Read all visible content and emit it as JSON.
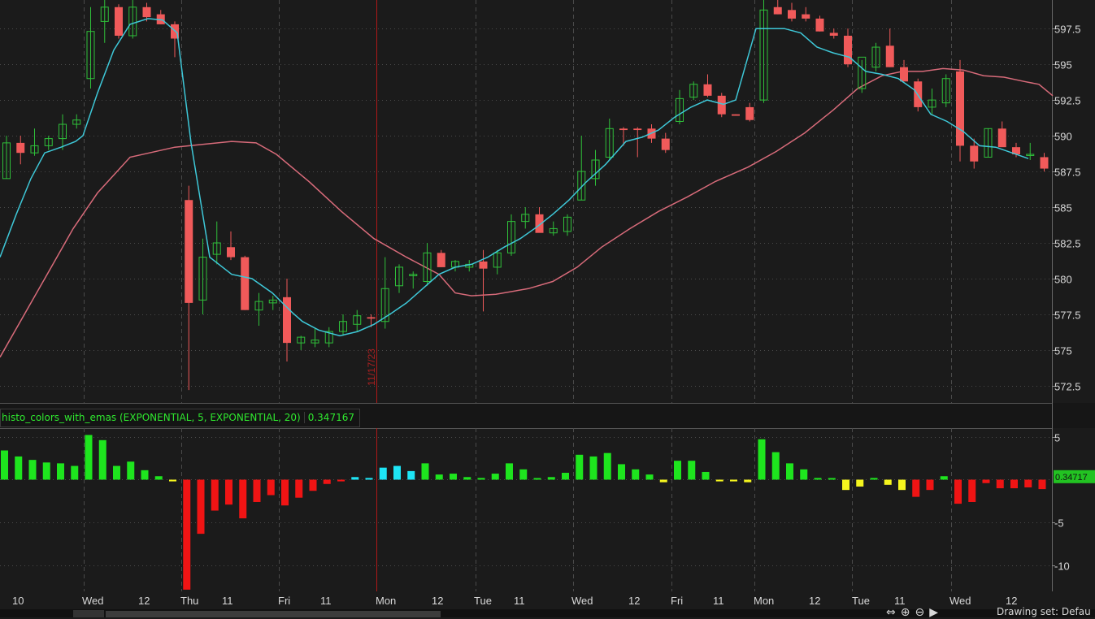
{
  "colors": {
    "background": "#1b1b1b",
    "grid": "#4a4a4a",
    "candle_up": "#2fc03a",
    "candle_down": "#f05a5a",
    "ema_fast": "#3ec8d8",
    "ema_slow": "#d86b7a",
    "histo_green": "#1ee51e",
    "histo_red": "#f01414",
    "histo_cyan": "#1ee5f5",
    "histo_yellow": "#f5f51e",
    "price_text": "#d8d8d8",
    "date_marker": "#b01818"
  },
  "date_marker_label": "11/17/23",
  "study": {
    "name": "histo_colors_with_emas (EXPONENTIAL, 5, EXPONENTIAL, 20)",
    "value": "0.347167",
    "value_badge": "0.34717"
  },
  "price_axis": {
    "ticks": [
      "597.5",
      "595",
      "592.5",
      "590",
      "587.5",
      "585",
      "582.5",
      "580",
      "577.5",
      "575",
      "572.5"
    ]
  },
  "histo_axis": {
    "ticks": [
      "5",
      "-5",
      "-10"
    ]
  },
  "time_axis": {
    "labels": [
      "10",
      "Wed",
      "12",
      "Thu",
      "11",
      "Fri",
      "11",
      "Mon",
      "12",
      "Tue",
      "11",
      "Wed",
      "12",
      "Fri",
      "11",
      "Mon",
      "12",
      "Tue",
      "11",
      "Wed",
      "12"
    ]
  },
  "status_bar": {
    "drawing_set": "Drawing set: Defau"
  },
  "chart_data": {
    "type": "candlestick",
    "price_range": [
      571.3,
      599.5
    ],
    "histogram_range": [
      -13,
      6
    ],
    "candles": [
      {
        "o": 587,
        "h": 590,
        "l": 587,
        "c": 589.5
      },
      {
        "o": 589.5,
        "h": 590,
        "l": 588,
        "c": 588.8
      },
      {
        "o": 588.8,
        "h": 590.5,
        "l": 588.6,
        "c": 589.3
      },
      {
        "o": 589.3,
        "h": 590,
        "l": 589,
        "c": 589.8
      },
      {
        "o": 589.8,
        "h": 591.5,
        "l": 589,
        "c": 590.8
      },
      {
        "o": 590.8,
        "h": 591.5,
        "l": 590.5,
        "c": 591.1
      },
      {
        "o": 594,
        "h": 599,
        "l": 593.3,
        "c": 597.3
      },
      {
        "o": 598,
        "h": 599.8,
        "l": 596.5,
        "c": 599
      },
      {
        "o": 599,
        "h": 599.2,
        "l": 596.8,
        "c": 597
      },
      {
        "o": 597,
        "h": 599.5,
        "l": 596.8,
        "c": 599
      },
      {
        "o": 599,
        "h": 599.3,
        "l": 598,
        "c": 598.3
      },
      {
        "o": 598.5,
        "h": 598.8,
        "l": 597.8,
        "c": 597.8
      },
      {
        "o": 597.8,
        "h": 598,
        "l": 595.5,
        "c": 596.8
      },
      {
        "o": 585.5,
        "h": 586.5,
        "l": 572.2,
        "c": 578.3
      },
      {
        "o": 578.5,
        "h": 582.8,
        "l": 577.5,
        "c": 581.5
      },
      {
        "o": 581.7,
        "h": 584,
        "l": 581,
        "c": 582.5
      },
      {
        "o": 582.2,
        "h": 583.3,
        "l": 581.3,
        "c": 581.5
      },
      {
        "o": 581.5,
        "h": 581.6,
        "l": 577.8,
        "c": 577.8
      },
      {
        "o": 577.8,
        "h": 579,
        "l": 576.7,
        "c": 578.4
      },
      {
        "o": 578.3,
        "h": 578.8,
        "l": 577.8,
        "c": 578.5
      },
      {
        "o": 578.7,
        "h": 580,
        "l": 574.2,
        "c": 575.5
      },
      {
        "o": 575.5,
        "h": 576,
        "l": 575,
        "c": 575.9
      },
      {
        "o": 575.5,
        "h": 576.5,
        "l": 575.2,
        "c": 575.7
      },
      {
        "o": 575.5,
        "h": 576.6,
        "l": 575.2,
        "c": 576.3
      },
      {
        "o": 576.3,
        "h": 577.5,
        "l": 576,
        "c": 577
      },
      {
        "o": 576.8,
        "h": 577.8,
        "l": 576.3,
        "c": 577.4
      },
      {
        "o": 577.3,
        "h": 577.5,
        "l": 576.6,
        "c": 577.2
      },
      {
        "o": 577,
        "h": 581.5,
        "l": 576.5,
        "c": 579.3
      },
      {
        "o": 579.5,
        "h": 581,
        "l": 579,
        "c": 580.8
      },
      {
        "o": 580.2,
        "h": 580.5,
        "l": 579.3,
        "c": 580.3
      },
      {
        "o": 579.8,
        "h": 582.5,
        "l": 579.5,
        "c": 581.8
      },
      {
        "o": 581.8,
        "h": 582,
        "l": 580.8,
        "c": 580.8
      },
      {
        "o": 580.8,
        "h": 581.3,
        "l": 580.5,
        "c": 581.2
      },
      {
        "o": 580.8,
        "h": 581.3,
        "l": 580.5,
        "c": 581
      },
      {
        "o": 581.2,
        "h": 582,
        "l": 577.7,
        "c": 580.7
      },
      {
        "o": 580.8,
        "h": 582,
        "l": 580.3,
        "c": 581.8
      },
      {
        "o": 581.8,
        "h": 584.5,
        "l": 581.6,
        "c": 584
      },
      {
        "o": 584,
        "h": 585,
        "l": 583.5,
        "c": 584.5
      },
      {
        "o": 584.5,
        "h": 585,
        "l": 583.5,
        "c": 583.2
      },
      {
        "o": 583.2,
        "h": 584,
        "l": 583,
        "c": 583.5
      },
      {
        "o": 583.3,
        "h": 584.5,
        "l": 583,
        "c": 584.3
      },
      {
        "o": 585.5,
        "h": 590,
        "l": 585.5,
        "c": 587.5
      },
      {
        "o": 587,
        "h": 589,
        "l": 586.5,
        "c": 588.3
      },
      {
        "o": 588.5,
        "h": 591.2,
        "l": 588.3,
        "c": 590.5
      },
      {
        "o": 590.5,
        "h": 590.6,
        "l": 589.3,
        "c": 590.4
      },
      {
        "o": 590.5,
        "h": 590.6,
        "l": 588.5,
        "c": 590.4
      },
      {
        "o": 590.5,
        "h": 590.8,
        "l": 589.5,
        "c": 589.8
      },
      {
        "o": 589.8,
        "h": 590.2,
        "l": 588.8,
        "c": 589
      },
      {
        "o": 591,
        "h": 593.2,
        "l": 590.8,
        "c": 592.6
      },
      {
        "o": 592.7,
        "h": 593.8,
        "l": 592.5,
        "c": 593.6
      },
      {
        "o": 593.6,
        "h": 594.3,
        "l": 592.7,
        "c": 592.8
      },
      {
        "o": 592.8,
        "h": 593,
        "l": 591.3,
        "c": 591.5
      },
      {
        "o": 591.5,
        "h": 591.5,
        "l": 591.4,
        "c": 591.4
      },
      {
        "o": 592,
        "h": 592.3,
        "l": 591,
        "c": 591.1
      },
      {
        "o": 592.5,
        "h": 599.5,
        "l": 592.3,
        "c": 598.8
      },
      {
        "o": 599,
        "h": 599.8,
        "l": 598.5,
        "c": 598.5
      },
      {
        "o": 598.8,
        "h": 599.3,
        "l": 598,
        "c": 598.2
      },
      {
        "o": 598.5,
        "h": 599,
        "l": 598,
        "c": 598.2
      },
      {
        "o": 598.2,
        "h": 598.4,
        "l": 597.3,
        "c": 597.3
      },
      {
        "o": 597.2,
        "h": 597.5,
        "l": 596.8,
        "c": 597
      },
      {
        "o": 597,
        "h": 597.5,
        "l": 594.8,
        "c": 595
      },
      {
        "o": 593.3,
        "h": 595.3,
        "l": 593,
        "c": 595.5
      },
      {
        "o": 594.8,
        "h": 596.5,
        "l": 594.5,
        "c": 596.2
      },
      {
        "o": 596.3,
        "h": 597.5,
        "l": 594.8,
        "c": 594.8
      },
      {
        "o": 594.8,
        "h": 595.3,
        "l": 593.8,
        "c": 593.8
      },
      {
        "o": 593.8,
        "h": 594,
        "l": 591.7,
        "c": 592
      },
      {
        "o": 592,
        "h": 593.3,
        "l": 591.5,
        "c": 592.5
      },
      {
        "o": 592.3,
        "h": 594.3,
        "l": 592,
        "c": 594
      },
      {
        "o": 594.5,
        "h": 595.3,
        "l": 588.2,
        "c": 589.3
      },
      {
        "o": 589.3,
        "h": 589.8,
        "l": 587.7,
        "c": 588.2
      },
      {
        "o": 588.5,
        "h": 590.5,
        "l": 588.5,
        "c": 590.5
      },
      {
        "o": 590.5,
        "h": 591,
        "l": 589.3,
        "c": 589.2
      },
      {
        "o": 589.2,
        "h": 589.5,
        "l": 588.5,
        "c": 588.7
      },
      {
        "o": 588.7,
        "h": 589.5,
        "l": 588.3,
        "c": 588.7
      },
      {
        "o": 588.5,
        "h": 588.8,
        "l": 587.5,
        "c": 587.7
      }
    ],
    "ema_fast": [
      581.5,
      584.5,
      587,
      588.8,
      589.2,
      589.6,
      590,
      593,
      596,
      597.8,
      598.2,
      598.1,
      597.2,
      589.5,
      581.5,
      580.3,
      580,
      579,
      577.6,
      577,
      576.4,
      576,
      576.3,
      576.8,
      577.6,
      578.3,
      579.3,
      580.3,
      580.8,
      581,
      581.5,
      582.2,
      582.8,
      583.6,
      584.5,
      585.5,
      586.7,
      588,
      589.6,
      589.9,
      590.4,
      591.3,
      592,
      592.5,
      592.2,
      592.5,
      597.5,
      597.5,
      597.2,
      596.2,
      595.8,
      595.5,
      594.5,
      594.3,
      594,
      593.2,
      591.5,
      591,
      590.3,
      589.3,
      589.2,
      588.8,
      588.4
    ],
    "ema_fast_x": [
      0,
      20,
      38,
      55,
      75,
      93,
      102,
      120,
      140,
      160,
      182,
      200,
      218,
      235,
      258,
      285,
      310,
      335,
      360,
      372,
      392,
      418,
      440,
      460,
      482,
      500,
      520,
      540,
      560,
      580,
      600,
      620,
      640,
      660,
      680,
      700,
      720,
      745,
      770,
      790,
      810,
      830,
      850,
      870,
      890,
      905,
      930,
      965,
      985,
      1005,
      1025,
      1045,
      1065,
      1085,
      1105,
      1125,
      1145,
      1165,
      1185,
      1205,
      1225,
      1245,
      1265,
      1285,
      1295
    ],
    "ema_slow": [
      574.5,
      577.5,
      580.5,
      583.5,
      586,
      588.5,
      589.2,
      589.6,
      589.5,
      588.7,
      586.8,
      584.7,
      582.8,
      581.5,
      580.3,
      579,
      578.8,
      578.9,
      579.3,
      579.8,
      580.8,
      582.2,
      583.5,
      584.7,
      585.7,
      586.8,
      587.8,
      588.9,
      590.2,
      591.8,
      593.3,
      594.2,
      594.5,
      594.5,
      594.7,
      594.6,
      594.2,
      594.1,
      593.8,
      593.6,
      592.8
    ],
    "ema_slow_x": [
      0,
      30,
      60,
      90,
      120,
      160,
      215,
      285,
      315,
      340,
      380,
      420,
      460,
      500,
      540,
      560,
      580,
      610,
      650,
      680,
      710,
      740,
      775,
      810,
      845,
      880,
      920,
      955,
      990,
      1025,
      1055,
      1085,
      1110,
      1135,
      1160,
      1185,
      1210,
      1235,
      1260,
      1278,
      1295
    ],
    "histogram": [
      {
        "v": 3.4,
        "c": "g"
      },
      {
        "v": 2.7,
        "c": "g"
      },
      {
        "v": 2.3,
        "c": "g"
      },
      {
        "v": 2,
        "c": "g"
      },
      {
        "v": 1.9,
        "c": "g"
      },
      {
        "v": 1.6,
        "c": "g"
      },
      {
        "v": 5.2,
        "c": "g"
      },
      {
        "v": 4.6,
        "c": "g"
      },
      {
        "v": 1.6,
        "c": "g"
      },
      {
        "v": 2.1,
        "c": "g"
      },
      {
        "v": 1.1,
        "c": "g"
      },
      {
        "v": 0.4,
        "c": "g"
      },
      {
        "v": -0.2,
        "c": "y"
      },
      {
        "v": -12.8,
        "c": "r"
      },
      {
        "v": -6.3,
        "c": "r"
      },
      {
        "v": -3.6,
        "c": "r"
      },
      {
        "v": -2.9,
        "c": "r"
      },
      {
        "v": -4.5,
        "c": "r"
      },
      {
        "v": -2.6,
        "c": "r"
      },
      {
        "v": -1.8,
        "c": "r"
      },
      {
        "v": -3,
        "c": "r"
      },
      {
        "v": -2.1,
        "c": "r"
      },
      {
        "v": -1.3,
        "c": "r"
      },
      {
        "v": -0.5,
        "c": "r"
      },
      {
        "v": -0.2,
        "c": "r"
      },
      {
        "v": 0.3,
        "c": "c"
      },
      {
        "v": 0.2,
        "c": "c"
      },
      {
        "v": 1.4,
        "c": "c"
      },
      {
        "v": 1.6,
        "c": "c"
      },
      {
        "v": 1,
        "c": "c"
      },
      {
        "v": 1.9,
        "c": "g"
      },
      {
        "v": 0.6,
        "c": "g"
      },
      {
        "v": 0.7,
        "c": "g"
      },
      {
        "v": 0.3,
        "c": "g"
      },
      {
        "v": 0.2,
        "c": "g"
      },
      {
        "v": 0.7,
        "c": "g"
      },
      {
        "v": 1.9,
        "c": "g"
      },
      {
        "v": 1.2,
        "c": "g"
      },
      {
        "v": 0.1,
        "c": "g"
      },
      {
        "v": 0.3,
        "c": "g"
      },
      {
        "v": 0.8,
        "c": "g"
      },
      {
        "v": 2.9,
        "c": "g"
      },
      {
        "v": 2.7,
        "c": "g"
      },
      {
        "v": 3.1,
        "c": "g"
      },
      {
        "v": 1.8,
        "c": "g"
      },
      {
        "v": 1.2,
        "c": "g"
      },
      {
        "v": 0.6,
        "c": "g"
      },
      {
        "v": -0.3,
        "c": "y"
      },
      {
        "v": 2.2,
        "c": "g"
      },
      {
        "v": 2.2,
        "c": "g"
      },
      {
        "v": 0.9,
        "c": "g"
      },
      {
        "v": -0.2,
        "c": "y"
      },
      {
        "v": -0.2,
        "c": "y"
      },
      {
        "v": -0.3,
        "c": "y"
      },
      {
        "v": 4.7,
        "c": "g"
      },
      {
        "v": 3.2,
        "c": "g"
      },
      {
        "v": 1.9,
        "c": "g"
      },
      {
        "v": 1.2,
        "c": "g"
      },
      {
        "v": 0.2,
        "c": "g"
      },
      {
        "v": 0,
        "c": "g"
      },
      {
        "v": -1.2,
        "c": "y"
      },
      {
        "v": -0.8,
        "c": "y"
      },
      {
        "v": 0.2,
        "c": "g"
      },
      {
        "v": -0.6,
        "c": "y"
      },
      {
        "v": -1.2,
        "c": "y"
      },
      {
        "v": -2,
        "c": "r"
      },
      {
        "v": -1.2,
        "c": "r"
      },
      {
        "v": 0.4,
        "c": "g"
      },
      {
        "v": -2.8,
        "c": "r"
      },
      {
        "v": -2.6,
        "c": "r"
      },
      {
        "v": -0.4,
        "c": "r"
      },
      {
        "v": -1,
        "c": "r"
      },
      {
        "v": -1,
        "c": "r"
      },
      {
        "v": -0.9,
        "c": "r"
      },
      {
        "v": -1.1,
        "c": "r"
      }
    ]
  }
}
